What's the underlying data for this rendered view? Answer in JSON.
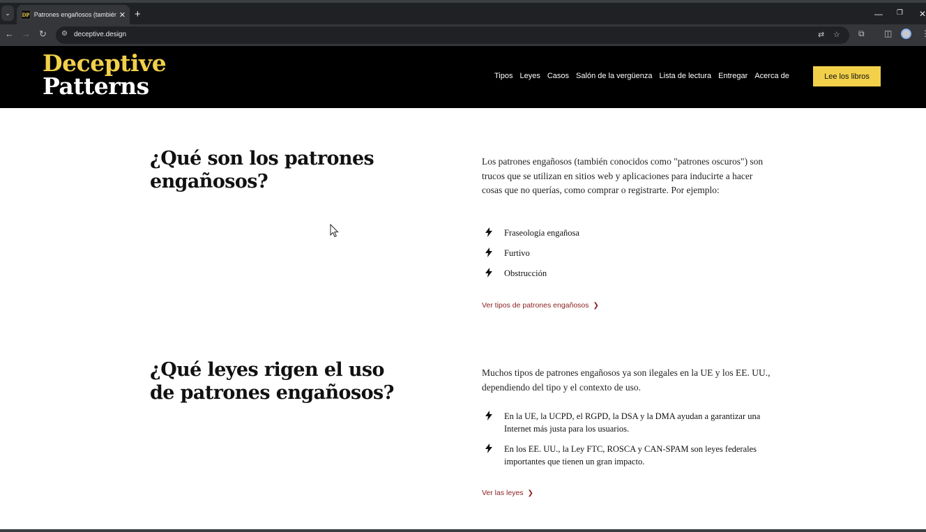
{
  "browser": {
    "tab_title": "Patrones engañosos (también c",
    "favicon_text": "DP",
    "url": "deceptive.design",
    "icons": [
      "chevron-down-icon",
      "close-icon",
      "plus-icon",
      "minimize-icon",
      "restore-icon",
      "back-icon",
      "forward-icon",
      "reload-icon",
      "site-settings-icon",
      "translate-icon",
      "star-icon",
      "extensions-icon",
      "split-view-icon",
      "avatar"
    ]
  },
  "header": {
    "logo_line1": "Deceptive",
    "logo_line2": "Patterns",
    "nav": [
      "Tipos",
      "Leyes",
      "Casos",
      "Salón de la vergüenza",
      "Lista de lectura",
      "Entregar",
      "Acerca de"
    ],
    "cta": "Lee los libros",
    "colors": {
      "background": "#000000",
      "accent": "#f2d04a"
    }
  },
  "section1": {
    "title": "¿Qué son los patrones engañosos?",
    "intro": "Los patrones engañosos (también conocidos como \"patrones oscuros\") son trucos que se utilizan en sitios web y aplicaciones para inducirte a hacer cosas que no querías, como comprar o registrarte. Por ejemplo:",
    "items": [
      "Fraseología engañosa",
      "Furtivo",
      "Obstrucción"
    ],
    "link": "Ver tipos de patrones engañosos"
  },
  "section2": {
    "title": "¿Qué leyes rigen el uso de patrones engañosos?",
    "intro": "Muchos tipos de patrones engañosos ya son ilegales en la UE y los EE. UU., dependiendo del tipo y el contexto de uso.",
    "items": [
      "En la UE, la UCPD, el RGPD, la DSA y la DMA ayudan a garantizar una Internet más justa para los usuarios.",
      "En los EE. UU., la Ley FTC, ROSCA y CAN-SPAM son leyes federales importantes que tienen un gran impacto."
    ],
    "link": "Ver las leyes"
  },
  "colors": {
    "link": "#8a1e1e"
  }
}
